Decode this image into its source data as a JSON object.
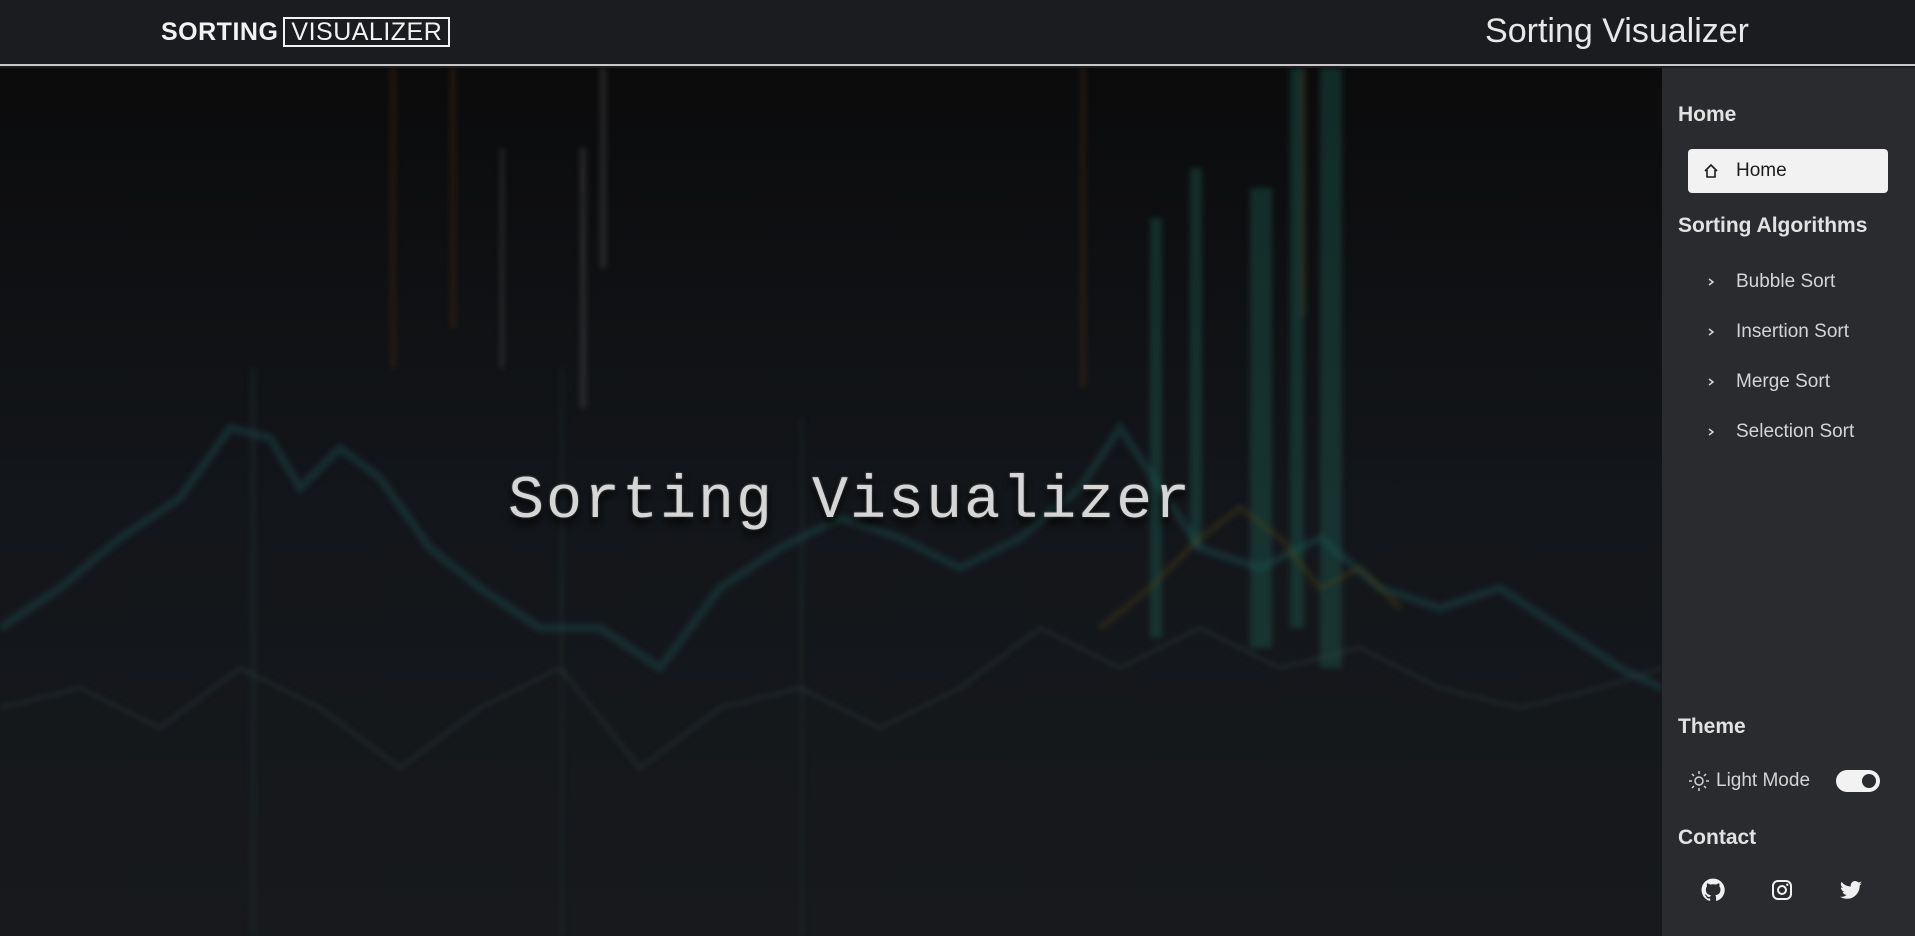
{
  "header": {
    "logo_left": "SORTING",
    "logo_right": "VISUALIZER",
    "title": "Sorting Visualizer"
  },
  "hero": {
    "title": "Sorting Visualizer"
  },
  "sidebar": {
    "home_heading": "Home",
    "home_item": {
      "label": "Home",
      "icon": "home-icon"
    },
    "algorithms_heading": "Sorting Algorithms",
    "algorithms": [
      {
        "label": "Bubble Sort",
        "icon": "chevron-right-icon"
      },
      {
        "label": "Insertion Sort",
        "icon": "chevron-right-icon"
      },
      {
        "label": "Merge Sort",
        "icon": "chevron-right-icon"
      },
      {
        "label": "Selection Sort",
        "icon": "chevron-right-icon"
      }
    ],
    "theme_heading": "Theme",
    "theme_label": "Light Mode",
    "theme_icon": "sun-icon",
    "contact_heading": "Contact",
    "contact_icons": [
      "github-icon",
      "instagram-icon",
      "twitter-icon"
    ]
  },
  "colors": {
    "topbar_bg": "#1b1c1f",
    "sidebar_bg": "#2a2b2e",
    "active_item_bg": "#f2f2f2",
    "text": "#d4d4d4"
  }
}
